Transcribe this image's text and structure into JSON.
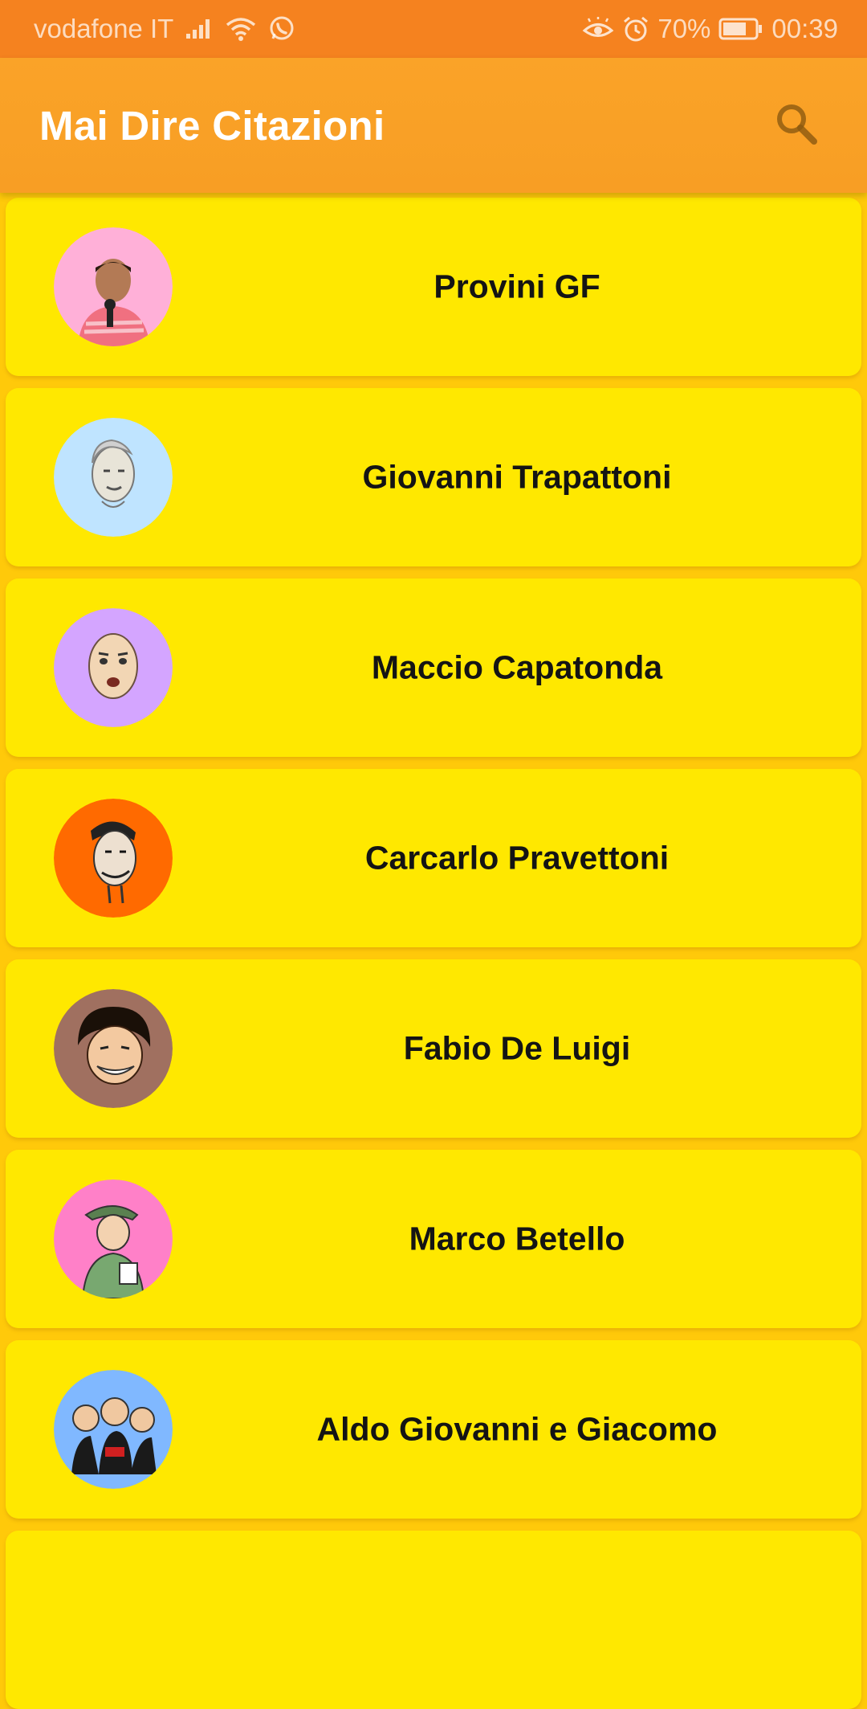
{
  "status_bar": {
    "carrier": "vodafone IT",
    "battery": "70%",
    "time": "00:39",
    "icons": [
      "signal-icon",
      "wifi-icon",
      "whatsapp-icon",
      "eye-comfort-icon",
      "alarm-icon",
      "battery-icon"
    ]
  },
  "app_bar": {
    "title": "Mai Dire Citazioni",
    "search_icon": "search-icon",
    "color": "#F9A126"
  },
  "colors": {
    "status_bar": "#F5821F",
    "background": "#FFC90A",
    "card": "#FFE800",
    "text": "#141414"
  },
  "list": {
    "items": [
      {
        "label": "Provini GF",
        "avatar_color": "#FFB0D8",
        "avatar_icon": "provini-gf-avatar-icon"
      },
      {
        "label": "Giovanni Trapattoni",
        "avatar_color": "#BFE4FF",
        "avatar_icon": "trapattoni-avatar-icon"
      },
      {
        "label": "Maccio Capatonda",
        "avatar_color": "#D4A5FF",
        "avatar_icon": "maccio-avatar-icon"
      },
      {
        "label": "Carcarlo Pravettoni",
        "avatar_color": "#FF6A00",
        "avatar_icon": "pravettoni-avatar-icon"
      },
      {
        "label": "Fabio De Luigi",
        "avatar_color": "#A07060",
        "avatar_icon": "de-luigi-avatar-icon"
      },
      {
        "label": "Marco Betello",
        "avatar_color": "#FF80C8",
        "avatar_icon": "betello-avatar-icon"
      },
      {
        "label": "Aldo Giovanni e Giacomo",
        "avatar_color": "#80B8FF",
        "avatar_icon": "aldo-giovanni-giacomo-avatar-icon"
      }
    ]
  }
}
